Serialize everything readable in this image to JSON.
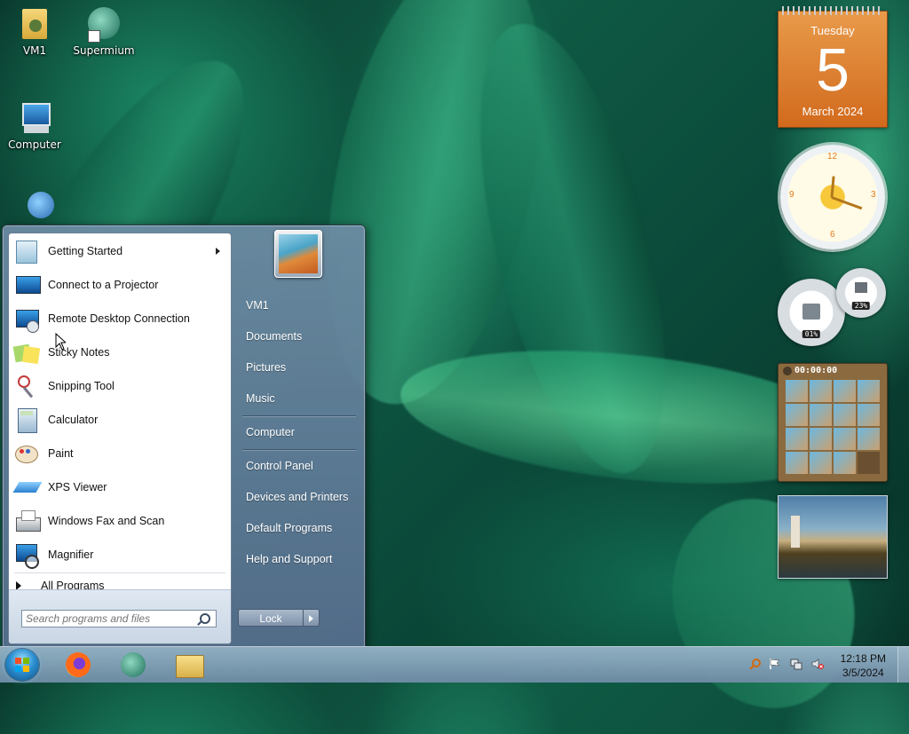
{
  "desktop": {
    "icons": [
      {
        "label": "VM1",
        "icon": "user-folder-icon"
      },
      {
        "label": "Supermium",
        "icon": "supermium-icon"
      },
      {
        "label": "Computer",
        "icon": "computer-icon"
      },
      {
        "label": "",
        "icon": "network-icon"
      }
    ]
  },
  "start_menu": {
    "programs": [
      {
        "label": "Getting Started",
        "icon": "getting-started-icon",
        "has_submenu": true
      },
      {
        "label": "Connect to a Projector",
        "icon": "projector-icon"
      },
      {
        "label": "Remote Desktop Connection",
        "icon": "remote-desktop-icon"
      },
      {
        "label": "Sticky Notes",
        "icon": "sticky-notes-icon"
      },
      {
        "label": "Snipping Tool",
        "icon": "scissors-icon"
      },
      {
        "label": "Calculator",
        "icon": "calculator-icon"
      },
      {
        "label": "Paint",
        "icon": "paint-icon"
      },
      {
        "label": "XPS Viewer",
        "icon": "xps-viewer-icon"
      },
      {
        "label": "Windows Fax and Scan",
        "icon": "fax-icon"
      },
      {
        "label": "Magnifier",
        "icon": "magnifier-icon"
      }
    ],
    "all_programs": "All Programs",
    "search_placeholder": "Search programs and files",
    "right_items": [
      "VM1",
      "Documents",
      "Pictures",
      "Music",
      "Computer",
      "Control Panel",
      "Devices and Printers",
      "Default Programs",
      "Help and Support"
    ],
    "lock_label": "Lock"
  },
  "taskbar": {
    "pinned": [
      "firefox-icon",
      "supermium-icon",
      "file-explorer-icon"
    ],
    "tray_icons": [
      "action-center-search-icon",
      "flag-icon",
      "network-icon",
      "volume-muted-icon"
    ],
    "time": "12:18 PM",
    "date": "3/5/2024"
  },
  "gadgets": {
    "calendar": {
      "weekday": "Tuesday",
      "day": "5",
      "month": "March 2024"
    },
    "clock": {
      "numbers": [
        "12",
        "3",
        "6",
        "9"
      ]
    },
    "cpu_meter": {
      "cpu": "01%",
      "memory": "23%"
    },
    "puzzle": {
      "timer": "00:00:00"
    }
  }
}
